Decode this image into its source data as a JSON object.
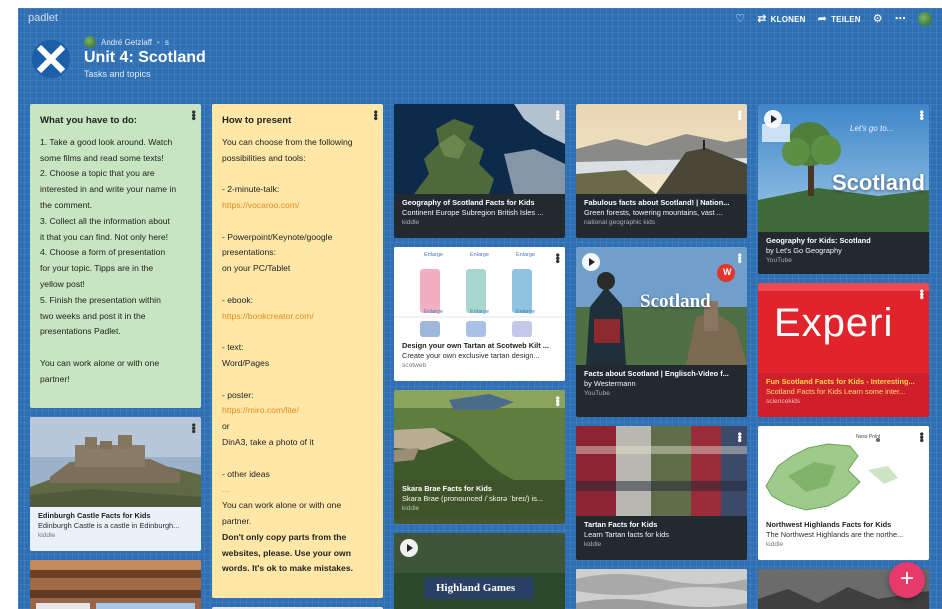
{
  "app": {
    "brand": "padlet"
  },
  "toolbar": {
    "clone_label": "KLONEN",
    "share_label": "TEILEN"
  },
  "board": {
    "author": "André Getzlaff",
    "author_dot": "•",
    "author_extra": "s",
    "title": "Unit 4: Scotland",
    "subtitle": "Tasks and topics"
  },
  "notes": {
    "todo": {
      "title": "What you have to do:",
      "lines": [
        "1. Take a good look around. Watch",
        "some films and read some texts!",
        "2. Choose a topic that you are",
        "interested in and write your name in",
        "the comment.",
        "3. Collect all the information about",
        "it that you can find. Not only here!",
        "4. Choose a form of presentation",
        "for your topic. Tipps are in the",
        "yellow post!",
        "5. Finish the presentation within",
        "two weeks and post it in the",
        "presentations Padlet.",
        "",
        "You can work alone or with one",
        "partner!"
      ]
    },
    "present": {
      "title": "How to present",
      "lines": [
        {
          "t": "You can choose from the following",
          "k": "n"
        },
        {
          "t": "possibilities and tools:",
          "k": "n"
        },
        {
          "t": "",
          "k": "n"
        },
        {
          "t": "- 2-minute-talk:",
          "k": "n"
        },
        {
          "t": "https://vocaroo.com/",
          "k": "l"
        },
        {
          "t": "",
          "k": "n"
        },
        {
          "t": "- Powerpoint/Keynote/google",
          "k": "n"
        },
        {
          "t": "presentations:",
          "k": "n"
        },
        {
          "t": "on your PC/Tablet",
          "k": "n"
        },
        {
          "t": "",
          "k": "n"
        },
        {
          "t": "- ebook:",
          "k": "n"
        },
        {
          "t": "https://bookcreator.com/",
          "k": "l"
        },
        {
          "t": "",
          "k": "n"
        },
        {
          "t": "- text:",
          "k": "n"
        },
        {
          "t": "Word/Pages",
          "k": "n"
        },
        {
          "t": "",
          "k": "n"
        },
        {
          "t": "- poster:",
          "k": "n"
        },
        {
          "t": "https://miro.com/lite/",
          "k": "l"
        },
        {
          "t": "or",
          "k": "n"
        },
        {
          "t": "DinA3, take a photo of it",
          "k": "n"
        },
        {
          "t": "",
          "k": "n"
        },
        {
          "t": "- other ideas",
          "k": "n"
        },
        {
          "t": "...",
          "k": "l"
        },
        {
          "t": "You can work alone or with one",
          "k": "n"
        },
        {
          "t": "partner.",
          "k": "n"
        },
        {
          "t": "Don't only copy parts from the",
          "k": "b"
        },
        {
          "t": "websites, please. Use your own",
          "k": "b"
        },
        {
          "t": "words. It's ok to make mistakes.",
          "k": "b"
        }
      ]
    }
  },
  "cards": {
    "edinburgh": {
      "title": "Edinburgh Castle Facts for Kids",
      "desc": "Edinburgh Castle is a castle in Edinburgh...",
      "source": "kiddle"
    },
    "geography": {
      "title": "Geography of Scotland Facts for Kids",
      "desc": "Continent Europe Subregion British Isles ...",
      "source": "kiddle"
    },
    "tartan_design": {
      "title": "Design your own Tartan at Scotweb Kilt ...",
      "desc": "Create your own exclusive tartan design...",
      "source": "scotweb",
      "enlarge": "Enlarge"
    },
    "skara": {
      "title": "Skara Brae Facts for Kids",
      "desc": "Skara Brae (pronounced /ˈskɑrə ˈbreɪ/) is...",
      "source": "kiddle"
    },
    "highland": {
      "overlay": "Highland Games"
    },
    "fabulous": {
      "title": "Fabulous facts about Scotland! | Nation...",
      "desc": "Green forests, towering mountains, vast ...",
      "source": "national geographic kids"
    },
    "facts_video": {
      "title": "Facts about Scotland | Englisch-Video f...",
      "desc": "by Westermann",
      "source": "YouTube",
      "overlay": "Scotland",
      "badge": "W"
    },
    "tartan_facts": {
      "title": "Tartan Facts for Kids",
      "desc": "Learn Tartan facts for kids",
      "source": "kiddle"
    },
    "geo_kids": {
      "title": "Geography for Kids: Scotland",
      "desc": "by Let's Go Geography",
      "source": "YouTube",
      "overlay": "Scotland",
      "overlay_small": "Let's go to..."
    },
    "fun_facts": {
      "title": "Fun Scotland Facts for Kids - Interesting...",
      "desc": "Scotland Facts for Kids Learn some inter...",
      "source": "sciencekids",
      "overlay": "Experi"
    },
    "northwest": {
      "title": "Northwest Highlands Facts for Kids",
      "desc": "The Northwest Highlands are the northe...",
      "source": "kiddle",
      "map_label": "Ness Point"
    }
  },
  "fab": {
    "label": "+"
  },
  "colors": {
    "board": "#2f6fb4",
    "note_green": "#c6e5c0",
    "note_yellow": "#ffe7a8",
    "link": "#e38b1c",
    "fab": "#e8396b",
    "red_card": "#cf1f2a"
  }
}
